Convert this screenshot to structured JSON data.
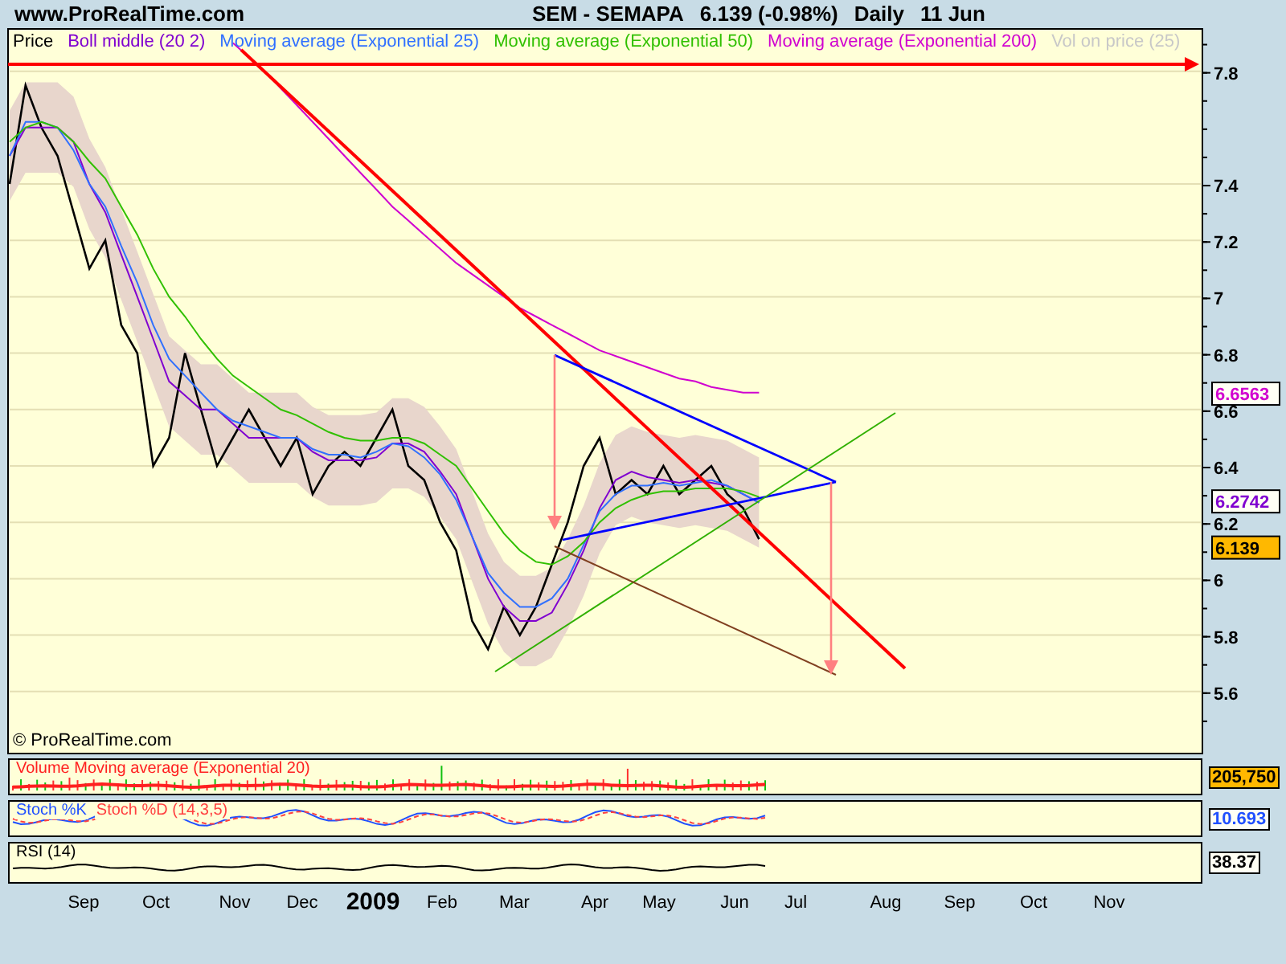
{
  "header": {
    "site": "www.ProRealTime.com",
    "title": "SEM - SEMAPA",
    "quote": "6.139 (-0.98%)",
    "period": "Daily",
    "date": "11 Jun"
  },
  "main_chart": {
    "y_label": "Price",
    "legend": [
      {
        "label": "Boll middle (20 2)",
        "color": "#8000d0"
      },
      {
        "label": "Moving average (Exponential 25)",
        "color": "#3070ff"
      },
      {
        "label": "Moving average (Exponential 50)",
        "color": "#30c000"
      },
      {
        "label": "Moving average (Exponential 200)",
        "color": "#d000d0"
      },
      {
        "label": "Vol on price (25)",
        "color": "#c8c8c8"
      }
    ],
    "y_axis_labels": [
      "7.8",
      "7.4",
      "7.2",
      "7",
      "6.8",
      "6.6",
      "6.4",
      "6.2",
      "6",
      "5.8",
      "5.6"
    ],
    "value_badges": [
      {
        "text": "6.6563",
        "color": "#d000d0",
        "kind": "outlined"
      },
      {
        "text": "6.2742",
        "color": "#8000d0",
        "kind": "outlined"
      },
      {
        "text": "6.139",
        "color": "#ffb800",
        "kind": "filled"
      }
    ],
    "copyright": "© ProRealTime.com"
  },
  "indicators": [
    {
      "kind": "volume",
      "labels": [
        {
          "text": "Volume Moving average (Exponential 20)",
          "color": "#ff2020"
        }
      ],
      "badge": {
        "text": "205,750",
        "color": "#ffb800",
        "kind": "filled"
      }
    },
    {
      "kind": "stochastic",
      "labels": [
        {
          "text": "Stoch %K",
          "color": "#2050ff"
        },
        {
          "text": "Stoch %D (14,3,5)",
          "color": "#ff4040"
        }
      ],
      "badge": {
        "text": "10.693",
        "color": "#2050ff",
        "kind": "outlined"
      }
    },
    {
      "kind": "rsi",
      "labels": [
        {
          "text": "RSI (14)",
          "color": "#000000"
        }
      ],
      "badge": {
        "text": "38.37",
        "color": "#000000",
        "kind": "outlined"
      }
    }
  ],
  "x_axis_labels": [
    {
      "text": "Sep",
      "bold": false
    },
    {
      "text": "Oct",
      "bold": false
    },
    {
      "text": "Nov",
      "bold": false
    },
    {
      "text": "Dec",
      "bold": false
    },
    {
      "text": "2009",
      "bold": true
    },
    {
      "text": "Feb",
      "bold": false
    },
    {
      "text": "Mar",
      "bold": false
    },
    {
      "text": "Apr",
      "bold": false
    },
    {
      "text": "May",
      "bold": false
    },
    {
      "text": "Jun",
      "bold": false
    },
    {
      "text": "Jul",
      "bold": false
    },
    {
      "text": "Aug",
      "bold": false
    },
    {
      "text": "Sep",
      "bold": false
    },
    {
      "text": "Oct",
      "bold": false
    },
    {
      "text": "Nov",
      "bold": false
    }
  ]
}
